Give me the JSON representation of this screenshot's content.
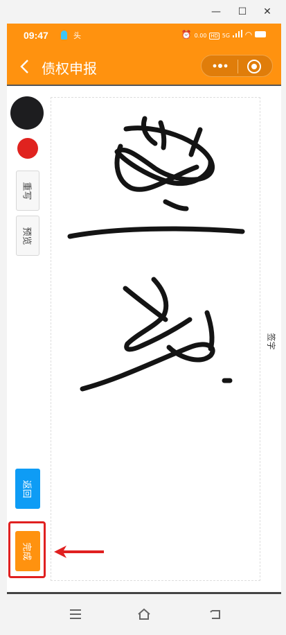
{
  "window": {
    "minimize_icon": "minimize-icon",
    "maximize_icon": "maximize-icon",
    "close_icon": "close-icon"
  },
  "status_bar": {
    "time": "09:47",
    "speed": "0.00\nKB/s",
    "network": "5G"
  },
  "header": {
    "title": "债权申报",
    "back_icon": "chevron-left-icon",
    "more_icon": "more-dots-icon",
    "target_icon": "target-icon"
  },
  "toolbar": {
    "colors": [
      "#1d1d1f",
      "#e0231f"
    ],
    "rewrite_label": "重写",
    "preview_label": "预览"
  },
  "canvas": {
    "side_label": "签字"
  },
  "actions": {
    "back_label": "返回",
    "done_label": "完成",
    "accent": "#ff920f",
    "blue": "#0e9cf5",
    "highlight": "#e02020"
  },
  "system_nav": {
    "menu_icon": "menu-icon",
    "home_icon": "home-icon",
    "back_icon": "back-icon"
  }
}
